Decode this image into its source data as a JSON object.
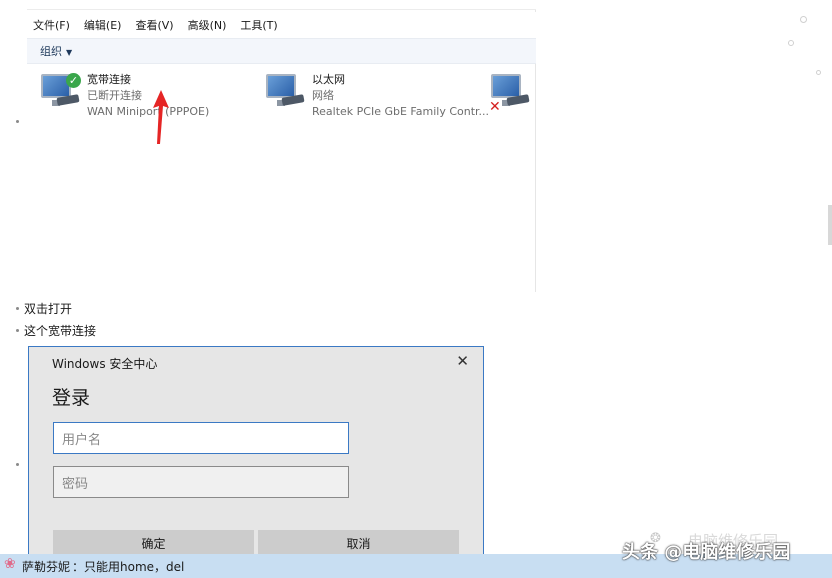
{
  "explorer": {
    "menu": [
      "文件(F)",
      "编辑(E)",
      "查看(V)",
      "高级(N)",
      "工具(T)"
    ],
    "organize_label": "组织",
    "connections": [
      {
        "name": "宽带连接",
        "status": "已断开连接",
        "device": "WAN Miniport (PPPOE)"
      },
      {
        "name": "以太网",
        "status": "网络",
        "device": "Realtek PCIe GbE Family Contr..."
      }
    ]
  },
  "bullets": [
    "双击打开",
    "这个宽带连接"
  ],
  "dialog": {
    "title": "Windows 安全中心",
    "close_glyph": "✕",
    "heading": "登录",
    "username_placeholder": "用户名",
    "password_placeholder": "密码",
    "ok_label": "确定",
    "cancel_label": "取消"
  },
  "comment": {
    "user": "萨勒芬妮",
    "separator": "：",
    "text": "只能用home，del"
  },
  "watermark": {
    "text": "头条 @电脑维修乐园",
    "ghost": "电脑维修乐园"
  },
  "colors": {
    "accent": "#3b79c4",
    "comment_bg": "#c8def2",
    "check": "#3aa64b",
    "error": "#d42020"
  }
}
